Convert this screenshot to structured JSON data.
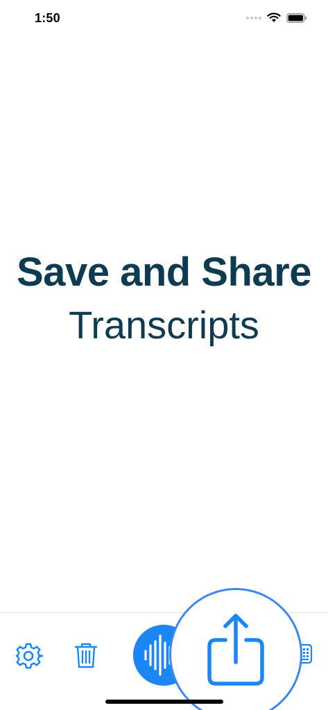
{
  "status_bar": {
    "time": "1:50"
  },
  "hero": {
    "title": "Save and Share",
    "subtitle": "Transcripts"
  },
  "tab_bar": {
    "items": [
      {
        "icon": "gear-icon"
      },
      {
        "icon": "trash-icon"
      },
      {
        "icon": "waveform-icon"
      },
      {
        "icon": "share-icon"
      },
      {
        "icon": "keypad-icon"
      }
    ]
  },
  "colors": {
    "accent": "#1a87f5",
    "text": "#0e3a52",
    "spotlight_ring": "#3c87f0"
  }
}
